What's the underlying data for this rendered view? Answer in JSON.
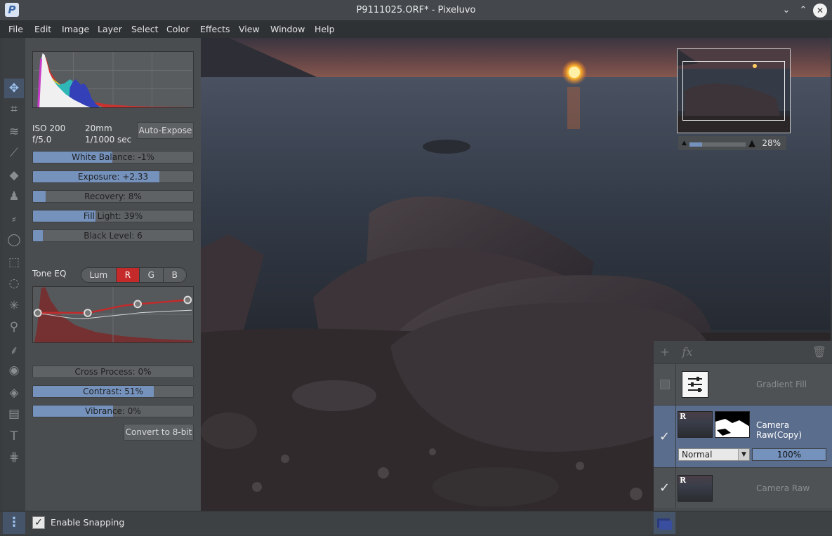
{
  "window": {
    "title": "P9111025.ORF* - Pixeluvo",
    "logo": "P",
    "min_icon": "chevron-down-icon",
    "max_icon": "chevron-up-icon",
    "close_icon": "close-icon",
    "min_glyph": "⌄",
    "max_glyph": "⌃",
    "close_glyph": "✕"
  },
  "menu": [
    "File",
    "Edit",
    "Image",
    "Layer",
    "Select",
    "Color",
    "Effects",
    "View",
    "Window",
    "Help"
  ],
  "tools": [
    {
      "name": "move-icon",
      "glyph": "✥",
      "active": true
    },
    {
      "name": "crop-icon",
      "glyph": "⌗",
      "active": false
    },
    {
      "name": "straighten-icon",
      "glyph": "≋",
      "active": false
    },
    {
      "name": "brush-icon",
      "glyph": "⟋",
      "active": false
    },
    {
      "name": "eraser-icon",
      "glyph": "◆",
      "active": false
    },
    {
      "name": "clone-stamp-icon",
      "glyph": "♟",
      "active": false
    },
    {
      "name": "healing-icon",
      "glyph": "⸗",
      "active": false
    },
    {
      "name": "lasso-icon",
      "glyph": "◯",
      "active": false
    },
    {
      "name": "rect-select-icon",
      "glyph": "⬚",
      "active": false
    },
    {
      "name": "ellipse-select-icon",
      "glyph": "◌",
      "active": false
    },
    {
      "name": "magic-wand-icon",
      "glyph": "✳",
      "active": false
    },
    {
      "name": "eyedropper-icon",
      "glyph": "⚲",
      "active": false
    },
    {
      "name": "smudge-icon",
      "glyph": "⸙",
      "active": false
    },
    {
      "name": "red-eye-icon",
      "glyph": "◉",
      "active": false
    },
    {
      "name": "paint-bucket-icon",
      "glyph": "◈",
      "active": false
    },
    {
      "name": "gradient-icon",
      "glyph": "▤",
      "active": false
    },
    {
      "name": "text-icon",
      "glyph": "T",
      "active": false
    },
    {
      "name": "perspective-icon",
      "glyph": "⋕",
      "active": false
    }
  ],
  "camera": {
    "iso": "ISO 200",
    "focal": "20mm",
    "aperture": "f/5.0",
    "shutter": "1/1000 sec"
  },
  "buttons": {
    "auto_expose": "Auto-Expose",
    "convert": "Convert to 8-bit"
  },
  "sliders": [
    {
      "label": "White Balance: -1%",
      "fill": 0.495
    },
    {
      "label": "Exposure: +2.33",
      "fill": 0.79
    },
    {
      "label": "Recovery: 8%",
      "fill": 0.08
    },
    {
      "label": "Fill Light: 39%",
      "fill": 0.39
    },
    {
      "label": "Black Level: 6",
      "fill": 0.06
    }
  ],
  "tone_eq": {
    "label": "Tone EQ",
    "channels": [
      "Lum",
      "R",
      "G",
      "B"
    ],
    "active": "R"
  },
  "sliders2": [
    {
      "label": "Cross Process: 0%",
      "fill": 0.0
    },
    {
      "label": "Contrast: 51%",
      "fill": 0.755
    },
    {
      "label": "Vibrance: 0%",
      "fill": 0.5
    }
  ],
  "navigator": {
    "zoom": "28%",
    "zoom_fraction": 0.28
  },
  "layers": [
    {
      "name": "Gradient Fill",
      "visible": false
    },
    {
      "name": "Camera Raw(Copy)",
      "visible": true,
      "blend": "Normal",
      "opacity": "100%",
      "selected": true,
      "thumb_badge": "R"
    },
    {
      "name": "Camera Raw",
      "visible": true,
      "thumb_badge": "R"
    }
  ],
  "layer_tools": {
    "add": "+",
    "fx": "fx",
    "trash": "🗑"
  },
  "status": {
    "snap_label": "Enable Snapping",
    "snap_checked": true,
    "check_glyph": "✓",
    "panel_glyph": "⋮"
  },
  "colors": {
    "accent": "#7592bd",
    "red_channel": "#c42a2a",
    "selected_layer": "#6e85a8"
  }
}
